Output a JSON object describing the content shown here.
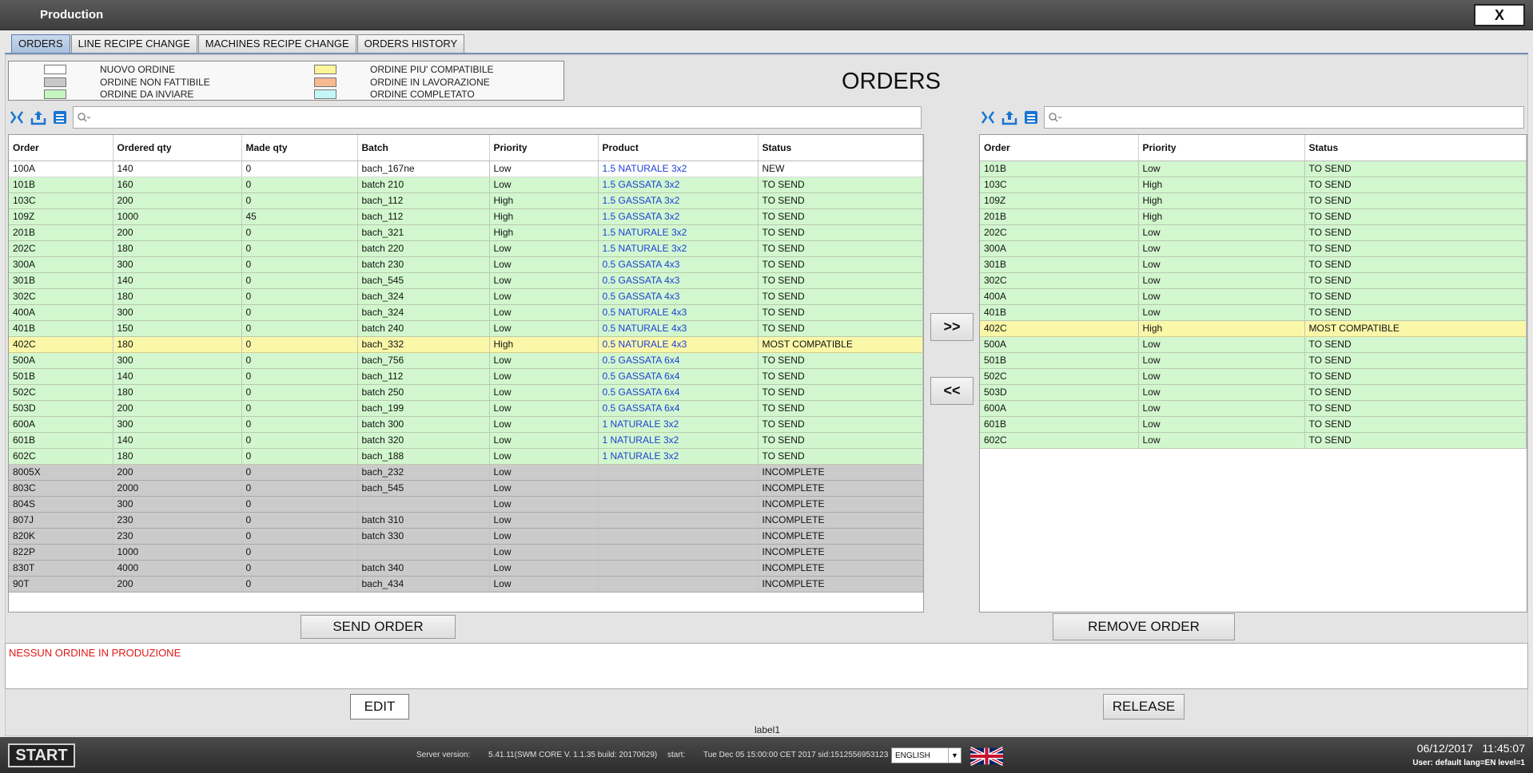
{
  "window": {
    "title": "Production",
    "close_label": "X"
  },
  "tabs": [
    {
      "label": "ORDERS",
      "active": true
    },
    {
      "label": "LINE RECIPE CHANGE"
    },
    {
      "label": "MACHINES RECIPE CHANGE"
    },
    {
      "label": "ORDERS HISTORY"
    }
  ],
  "legend": [
    {
      "label": "NUOVO ORDINE",
      "color": "#ffffff"
    },
    {
      "label": "ORDINE NON FATTIBILE",
      "color": "#c8c8c8"
    },
    {
      "label": "ORDINE DA INVIARE",
      "color": "#c5f5c0"
    },
    {
      "label": "ORDINE PIU' COMPATIBILE",
      "color": "#fdf59a"
    },
    {
      "label": "ORDINE IN LAVORAZIONE",
      "color": "#f6b990"
    },
    {
      "label": "ORDINE COMPLETATO",
      "color": "#c5f5f5"
    }
  ],
  "page_title": "ORDERS",
  "left_table": {
    "columns": [
      "Order",
      "Ordered qty",
      "Made qty",
      "Batch",
      "Priority",
      "Product",
      "Status"
    ],
    "rows": [
      [
        "100A",
        "140",
        "0",
        "bach_167ne",
        "Low",
        "1.5 NATURALE 3x2",
        "NEW"
      ],
      [
        "101B",
        "160",
        "0",
        "batch 210",
        "Low",
        "1.5 GASSATA 3x2",
        "TO SEND"
      ],
      [
        "103C",
        "200",
        "0",
        "bach_112",
        "High",
        "1.5 GASSATA 3x2",
        "TO SEND"
      ],
      [
        "109Z",
        "1000",
        "45",
        "bach_112",
        "High",
        "1.5 GASSATA 3x2",
        "TO SEND"
      ],
      [
        "201B",
        "200",
        "0",
        "bach_321",
        "High",
        "1.5 NATURALE 3x2",
        "TO SEND"
      ],
      [
        "202C",
        "180",
        "0",
        "batch 220",
        "Low",
        "1.5 NATURALE 3x2",
        "TO SEND"
      ],
      [
        "300A",
        "300",
        "0",
        "batch 230",
        "Low",
        "0.5 GASSATA 4x3",
        "TO SEND"
      ],
      [
        "301B",
        "140",
        "0",
        "bach_545",
        "Low",
        "0.5 GASSATA 4x3",
        "TO SEND"
      ],
      [
        "302C",
        "180",
        "0",
        "bach_324",
        "Low",
        "0.5 GASSATA 4x3",
        "TO SEND"
      ],
      [
        "400A",
        "300",
        "0",
        "bach_324",
        "Low",
        "0.5 NATURALE 4x3",
        "TO SEND"
      ],
      [
        "401B",
        "150",
        "0",
        "batch 240",
        "Low",
        "0.5 NATURALE 4x3",
        "TO SEND"
      ],
      [
        "402C",
        "180",
        "0",
        "bach_332",
        "High",
        "0.5 NATURALE 4x3",
        "MOST COMPATIBLE"
      ],
      [
        "500A",
        "300",
        "0",
        "bach_756",
        "Low",
        "0.5 GASSATA 6x4",
        "TO SEND"
      ],
      [
        "501B",
        "140",
        "0",
        "bach_112",
        "Low",
        "0.5 GASSATA 6x4",
        "TO SEND"
      ],
      [
        "502C",
        "180",
        "0",
        "batch 250",
        "Low",
        "0.5 GASSATA 6x4",
        "TO SEND"
      ],
      [
        "503D",
        "200",
        "0",
        "bach_199",
        "Low",
        "0.5 GASSATA 6x4",
        "TO SEND"
      ],
      [
        "600A",
        "300",
        "0",
        "batch 300",
        "Low",
        "1 NATURALE 3x2",
        "TO SEND"
      ],
      [
        "601B",
        "140",
        "0",
        "batch 320",
        "Low",
        "1 NATURALE 3x2",
        "TO SEND"
      ],
      [
        "602C",
        "180",
        "0",
        "bach_188",
        "Low",
        "1 NATURALE 3x2",
        "TO SEND"
      ],
      [
        "8005X",
        "200",
        "0",
        "bach_232",
        "Low",
        "",
        "INCOMPLETE"
      ],
      [
        "803C",
        "2000",
        "0",
        "bach_545",
        "Low",
        "",
        "INCOMPLETE"
      ],
      [
        "804S",
        "300",
        "0",
        "",
        "Low",
        "",
        "INCOMPLETE"
      ],
      [
        "807J",
        "230",
        "0",
        "batch 310",
        "Low",
        "",
        "INCOMPLETE"
      ],
      [
        "820K",
        "230",
        "0",
        "batch 330",
        "Low",
        "",
        "INCOMPLETE"
      ],
      [
        "822P",
        "1000",
        "0",
        "",
        "Low",
        "",
        "INCOMPLETE"
      ],
      [
        "830T",
        "4000",
        "0",
        "batch 340",
        "Low",
        "",
        "INCOMPLETE"
      ],
      [
        "90T",
        "200",
        "0",
        "bach_434",
        "Low",
        "",
        "INCOMPLETE"
      ]
    ]
  },
  "right_table": {
    "columns": [
      "Order",
      "Priority",
      "Status"
    ],
    "rows": [
      [
        "101B",
        "Low",
        "TO SEND"
      ],
      [
        "103C",
        "High",
        "TO SEND"
      ],
      [
        "109Z",
        "High",
        "TO SEND"
      ],
      [
        "201B",
        "High",
        "TO SEND"
      ],
      [
        "202C",
        "Low",
        "TO SEND"
      ],
      [
        "300A",
        "Low",
        "TO SEND"
      ],
      [
        "301B",
        "Low",
        "TO SEND"
      ],
      [
        "302C",
        "Low",
        "TO SEND"
      ],
      [
        "400A",
        "Low",
        "TO SEND"
      ],
      [
        "401B",
        "Low",
        "TO SEND"
      ],
      [
        "402C",
        "High",
        "MOST COMPATIBLE"
      ],
      [
        "500A",
        "Low",
        "TO SEND"
      ],
      [
        "501B",
        "Low",
        "TO SEND"
      ],
      [
        "502C",
        "Low",
        "TO SEND"
      ],
      [
        "503D",
        "Low",
        "TO SEND"
      ],
      [
        "600A",
        "Low",
        "TO SEND"
      ],
      [
        "601B",
        "Low",
        "TO SEND"
      ],
      [
        "602C",
        "Low",
        "TO SEND"
      ]
    ]
  },
  "buttons": {
    "move_right": ">>",
    "move_left": "<<",
    "send_order": "SEND ORDER",
    "remove_order": "REMOVE ORDER",
    "edit": "EDIT",
    "release": "RELEASE"
  },
  "message": "NESSUN ORDINE IN PRODUZIONE",
  "label1": "label1",
  "statusbar": {
    "start": "START",
    "server_version_label": "Server version:",
    "server_version_value": "5.41.11(SWM CORE V. 1.1.35 build: 20170629)",
    "start_label": "start:",
    "start_value": "Tue Dec 05 15:00:00 CET 2017 sid:1512556953123",
    "language": "ENGLISH",
    "date": "06/12/2017",
    "time": "11:45:07",
    "user_info": "User: default lang=EN level=1"
  },
  "colors": {
    "to_send": "#d2f7ce",
    "most_compatible": "#fbf7a8",
    "incomplete": "#cbcbcb",
    "product_link": "#1d3fd8",
    "message": "#e01919"
  }
}
